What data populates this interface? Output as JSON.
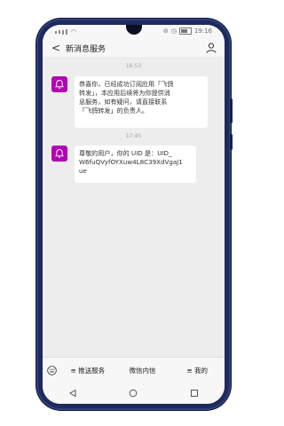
{
  "statusbar": {
    "time": "19:16"
  },
  "header": {
    "back_glyph": "<",
    "title": "新消息服务",
    "user_icon": "person-icon"
  },
  "messages": [
    {
      "time": "16:53",
      "text": "恭喜你，已经成功订阅应用「飞鸽\n转发」，本应用后续将为你提供消\n息服务，如有疑问，请直接联系\n「飞鸽转发」的负责人。"
    },
    {
      "time": "17:45",
      "text": "尊敬的用户，你的 UID 是：UID_\nW6fuQVyfOYXuw4L8C39XdVgaJ1\nue"
    }
  ],
  "bottom_menu": {
    "items": [
      "≡ 推送服务",
      "微信内信",
      "≡ 我的"
    ]
  },
  "colors": {
    "avatar": "#b200b2",
    "phone_body": "#1e2a5a"
  }
}
